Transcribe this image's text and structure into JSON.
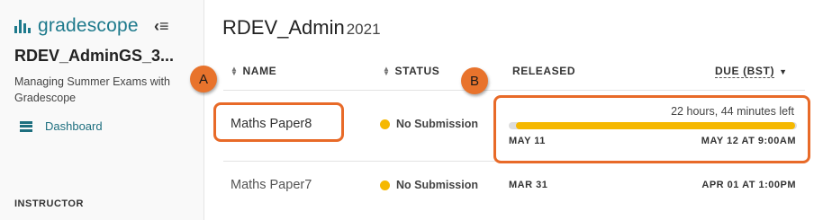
{
  "sidebar": {
    "logo_text": "gradescope",
    "course_name": "RDEV_AdminGS_3...",
    "course_description": "Managing Summer Exams with Gradescope",
    "nav": [
      {
        "label": "Dashboard",
        "icon": "dashboard-icon"
      }
    ],
    "section_label": "INSTRUCTOR"
  },
  "main": {
    "title": "RDEV_Admin",
    "title_suffix": "2021",
    "columns": {
      "name": "NAME",
      "status": "STATUS",
      "released": "RELEASED",
      "due": "DUE (BST)"
    },
    "assignments": [
      {
        "name": "Maths Paper8",
        "status": "No Submission",
        "time_left": "22 hours, 44 minutes left",
        "progress_fraction": 0.97,
        "released": "MAY 11",
        "due": "MAY 12 AT 9:00AM"
      },
      {
        "name": "Maths Paper7",
        "status": "No Submission",
        "released": "MAR 31",
        "due": "APR 01 AT 1:00PM"
      }
    ]
  },
  "callouts": {
    "a": "A",
    "b": "B"
  },
  "colors": {
    "brand": "#1e7a8c",
    "status_dot": "#f5b800",
    "callout": "#e86a28"
  }
}
